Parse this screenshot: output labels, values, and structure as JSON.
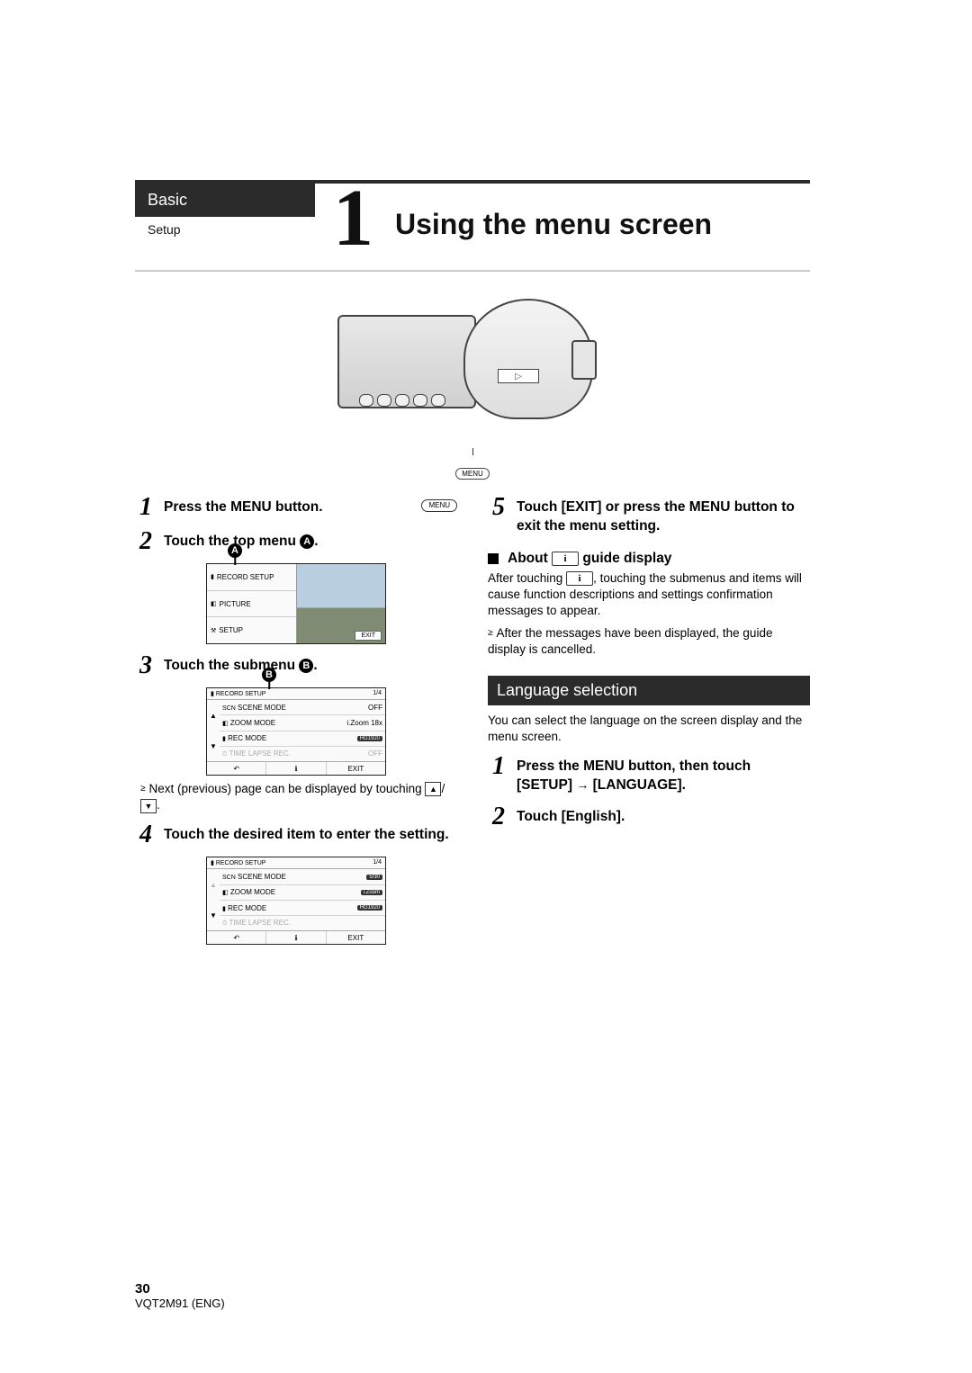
{
  "header": {
    "category": "Basic",
    "subcategory": "Setup",
    "chapter_number": "1",
    "title": "Using the menu screen",
    "menu_button_label": "MENU"
  },
  "left": {
    "step1": {
      "num": "1",
      "text_a": "Press the MENU button.",
      "inline_label": "MENU"
    },
    "step2": {
      "num": "2",
      "text_a": "Touch the top menu ",
      "callout": "A",
      "period": "."
    },
    "menuA": {
      "items": [
        "RECORD SETUP",
        "PICTURE",
        "SETUP"
      ],
      "exit": "EXIT"
    },
    "step3": {
      "num": "3",
      "text_a": "Touch the submenu ",
      "callout": "B",
      "period": "."
    },
    "menuB": {
      "title_left": "RECORD SETUP",
      "title_right": "1/4",
      "rows": [
        {
          "label": "SCENE MODE",
          "value": "OFF"
        },
        {
          "label": "ZOOM MODE",
          "value": "i.Zoom 18x"
        },
        {
          "label": "REC MODE",
          "value": "HG1920"
        },
        {
          "label": "TIME LAPSE REC.",
          "value": "OFF",
          "dim": true
        }
      ],
      "footer": [
        "↶",
        "ℹ",
        "EXIT"
      ]
    },
    "noteB": {
      "bullet": "≥",
      "text_a": "Next (previous) page can be displayed by touching ",
      "key_up": "▲",
      "sep": "/",
      "key_down": "▼",
      "period": "."
    },
    "step4": {
      "num": "4",
      "text": "Touch the desired item to enter the setting."
    },
    "menuC": {
      "title_left": "RECORD SETUP",
      "title_right": "1/4",
      "rows": [
        {
          "label": "SCENE MODE",
          "value": "5/30",
          "chip": true
        },
        {
          "label": "ZOOM MODE",
          "value": "i.Zoom",
          "chip": true
        },
        {
          "label": "REC MODE",
          "value": "HG1920",
          "chip": true
        },
        {
          "label": "TIME LAPSE REC.",
          "value": "",
          "dim": true
        }
      ],
      "footer": [
        "↶",
        "ℹ",
        "EXIT"
      ]
    }
  },
  "right": {
    "step5": {
      "num": "5",
      "text": "Touch [EXIT] or press the MENU button to exit the menu setting."
    },
    "about": {
      "heading_a": "About ",
      "heading_b": " guide display",
      "p1_a": "After touching ",
      "p1_b": ", touching the submenus and items will cause function descriptions and settings confirmation messages to appear.",
      "bullet": "≥",
      "p2": "After the messages have been displayed, the guide display is cancelled."
    },
    "lang": {
      "heading": "Language selection",
      "intro": "You can select the language on the screen display and the menu screen.",
      "step1": {
        "num": "1",
        "text_a": "Press the MENU button, then touch [SETUP] ",
        "arrow": "→",
        "text_b": " [LANGUAGE]."
      },
      "step2": {
        "num": "2",
        "text": "Touch [English]."
      }
    }
  },
  "footer": {
    "page": "30",
    "doc": "VQT2M91 (ENG)"
  }
}
